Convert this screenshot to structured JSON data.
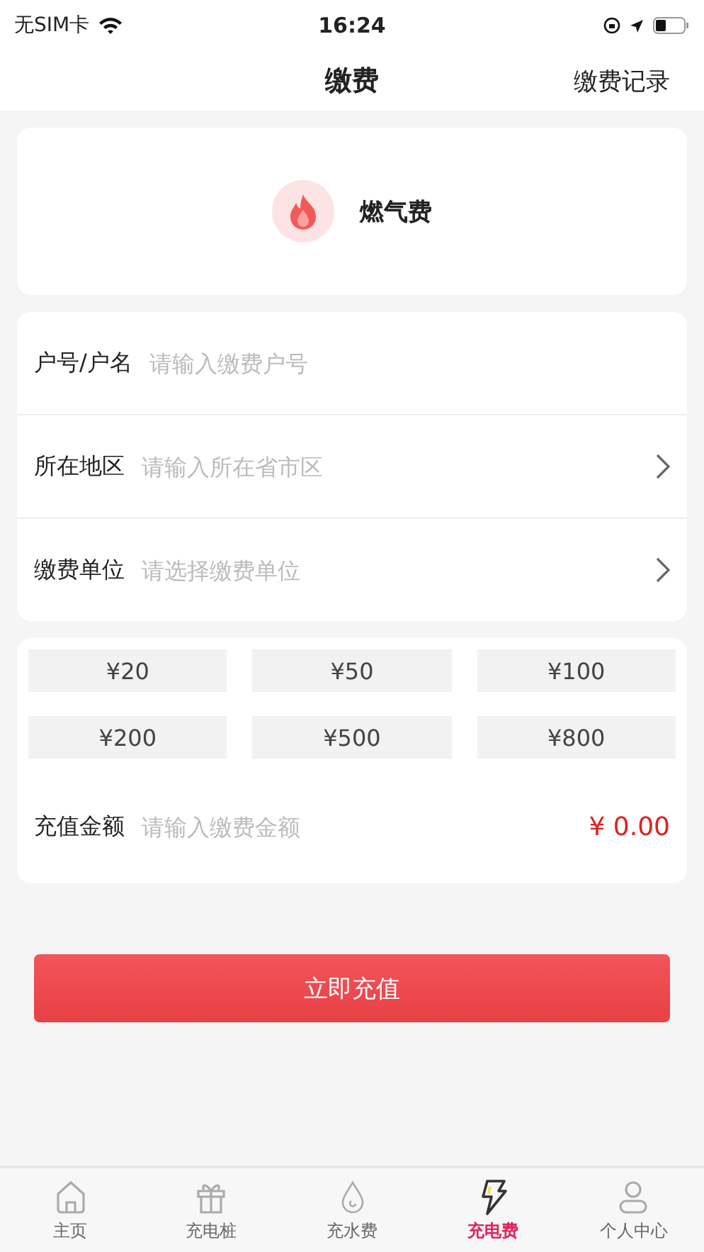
{
  "status_bar": {
    "carrier": "无SIM卡",
    "time": "16:24"
  },
  "nav": {
    "title": "缴费",
    "action": "缴费记录"
  },
  "service": {
    "name": "燃气费"
  },
  "form_rows": [
    {
      "label": "户号/户名",
      "placeholder": "请输入缴费户号",
      "kind": "input"
    },
    {
      "label": "所在地区",
      "placeholder": "请输入所在省市区",
      "kind": "select"
    },
    {
      "label": "缴费单位",
      "placeholder": "请选择缴费单位",
      "kind": "select"
    }
  ],
  "amounts": [
    "¥20",
    "¥50",
    "¥100",
    "¥200",
    "¥500",
    "¥800"
  ],
  "amount_row": {
    "label": "充值金额",
    "placeholder": "请输入缴费金额",
    "total": "¥ 0.00"
  },
  "submit": "立即充值",
  "tabs": [
    {
      "label": "主页",
      "selected": false
    },
    {
      "label": "充电桩",
      "selected": false
    },
    {
      "label": "充水费",
      "selected": false
    },
    {
      "label": "充电费",
      "selected": true
    },
    {
      "label": "个人中心",
      "selected": false
    }
  ]
}
